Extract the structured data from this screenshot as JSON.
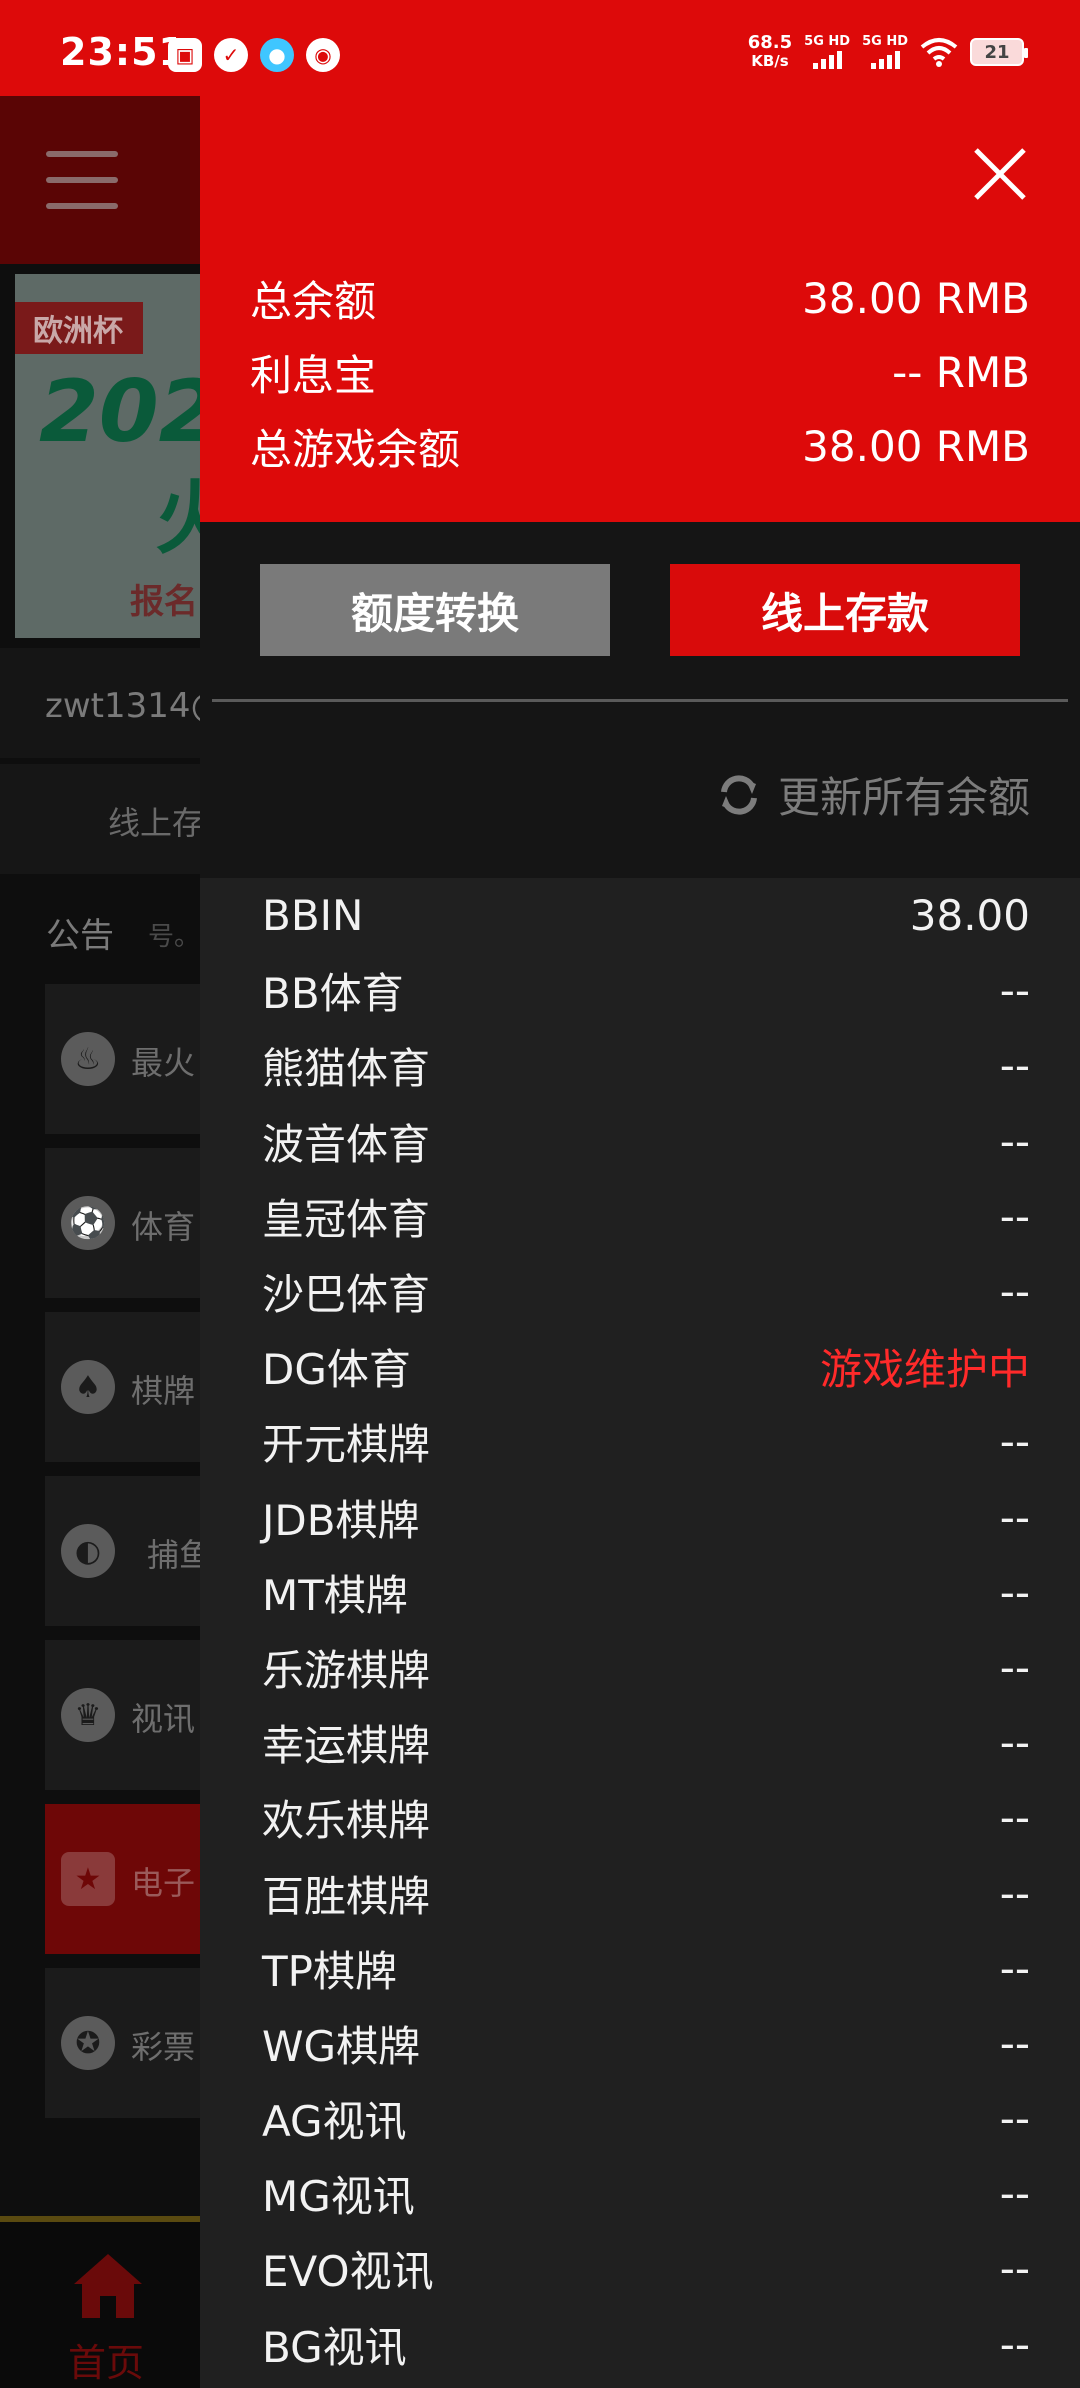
{
  "status_bar": {
    "time": "23:51",
    "net_speed": "68.5",
    "net_unit": "KB/s",
    "sim1": "5G HD",
    "sim2": "5G HD",
    "battery": "21",
    "icons": [
      "calendar-icon",
      "check-circle-icon",
      "qq-icon",
      "wechat-icon",
      "wifi-icon"
    ]
  },
  "background": {
    "banner_tag": "欧洲杯",
    "banner_big": "202",
    "banner_fire": "火",
    "banner_small": "报名",
    "username": "zwt1314@",
    "tab_deposit": "线上存",
    "notice_label": "公告",
    "notice_text": "号。",
    "categories": [
      {
        "label": "最火",
        "icon": "fire-icon"
      },
      {
        "label": "体育",
        "icon": "soccer-ball-icon"
      },
      {
        "label": "棋牌",
        "icon": "cards-icon"
      },
      {
        "label": "捕鱼",
        "icon": "fish-icon"
      },
      {
        "label": "视讯",
        "icon": "poker-chip-icon"
      },
      {
        "label": "电子",
        "icon": "slot-machine-icon"
      },
      {
        "label": "彩票",
        "icon": "lottery-ball-icon"
      }
    ],
    "bottom_nav_home": "首页"
  },
  "drawer": {
    "balances": [
      {
        "label": "总余额",
        "value": "38.00 RMB"
      },
      {
        "label": "利息宝",
        "value": "-- RMB"
      },
      {
        "label": "总游戏余额",
        "value": "38.00 RMB"
      }
    ],
    "transfer_button": "额度转换",
    "deposit_button": "线上存款",
    "refresh_label": "更新所有余额",
    "games": [
      {
        "name": "BBIN",
        "value": "38.00"
      },
      {
        "name": "BB体育",
        "value": "--"
      },
      {
        "name": "熊猫体育",
        "value": "--"
      },
      {
        "name": "波音体育",
        "value": "--"
      },
      {
        "name": "皇冠体育",
        "value": "--"
      },
      {
        "name": "沙巴体育",
        "value": "--"
      },
      {
        "name": "DG体育",
        "value": "游戏维护中"
      },
      {
        "name": "开元棋牌",
        "value": "--"
      },
      {
        "name": "JDB棋牌",
        "value": "--"
      },
      {
        "name": "MT棋牌",
        "value": "--"
      },
      {
        "name": "乐游棋牌",
        "value": "--"
      },
      {
        "name": "幸运棋牌",
        "value": "--"
      },
      {
        "name": "欢乐棋牌",
        "value": "--"
      },
      {
        "name": "百胜棋牌",
        "value": "--"
      },
      {
        "name": "TP棋牌",
        "value": "--"
      },
      {
        "name": "WG棋牌",
        "value": "--"
      },
      {
        "name": "AG视讯",
        "value": "--"
      },
      {
        "name": "MG视讯",
        "value": "--"
      },
      {
        "name": "EVO视讯",
        "value": "--"
      },
      {
        "name": "BG视讯",
        "value": "--"
      }
    ],
    "colors": {
      "accent": "#dd0a0a",
      "warning": "#ff2a2a"
    }
  }
}
